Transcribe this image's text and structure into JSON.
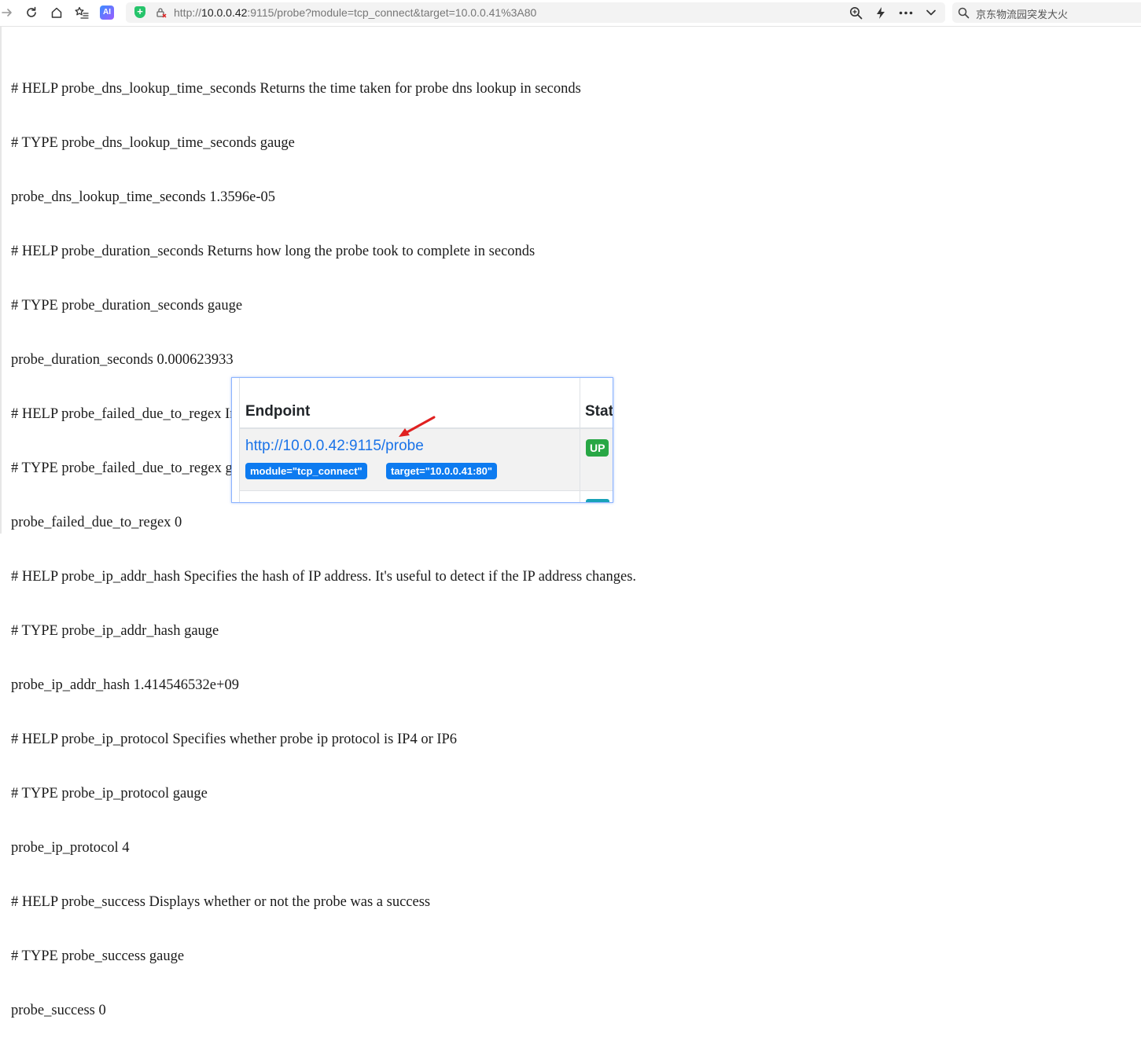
{
  "browser": {
    "url_prefix": "http://",
    "url_host": "10.0.0.42",
    "url_rest": ":9115/probe?module=tcp_connect&target=10.0.0.41%3A80",
    "search_placeholder": "京东物流园突发大火",
    "ai_badge": "AI"
  },
  "metrics": [
    "# HELP probe_dns_lookup_time_seconds Returns the time taken for probe dns lookup in seconds",
    "# TYPE probe_dns_lookup_time_seconds gauge",
    "probe_dns_lookup_time_seconds 1.3596e-05",
    "# HELP probe_duration_seconds Returns how long the probe took to complete in seconds",
    "# TYPE probe_duration_seconds gauge",
    "probe_duration_seconds 0.000623933",
    "# HELP probe_failed_due_to_regex Indicates if probe failed due to regex",
    "# TYPE probe_failed_due_to_regex gauge",
    "probe_failed_due_to_regex 0",
    "# HELP probe_ip_addr_hash Specifies the hash of IP address. It's useful to detect if the IP address changes.",
    "# TYPE probe_ip_addr_hash gauge",
    "probe_ip_addr_hash 1.414546532e+09",
    "# HELP probe_ip_protocol Specifies whether probe ip protocol is IP4 or IP6",
    "# TYPE probe_ip_protocol gauge",
    "probe_ip_protocol 4",
    "# HELP probe_success Displays whether or not the probe was a success",
    "# TYPE probe_success gauge",
    "probe_success 0"
  ],
  "targets_panel": {
    "col_endpoint": "Endpoint",
    "col_state": "Stat",
    "endpoint_url": "http://10.0.0.42:9115/probe",
    "labels": [
      "module=\"tcp_connect\"",
      "target=\"10.0.0.41:80\""
    ],
    "state": "UP"
  },
  "icons": {
    "back": "arrow-right-icon",
    "reload": "reload-icon",
    "home": "home-icon",
    "favorites": "star-list-icon",
    "zoom": "zoom-icon",
    "lightning": "lightning-icon",
    "more": "more-dots-icon",
    "dropdown": "chevron-down-icon",
    "search": "search-icon"
  },
  "colors": {
    "link": "#1a73e8",
    "label_badge": "#0d7bf0",
    "up_badge": "#28a745",
    "annotation_arrow": "#e02020",
    "secure_shield": "#26c46b"
  }
}
